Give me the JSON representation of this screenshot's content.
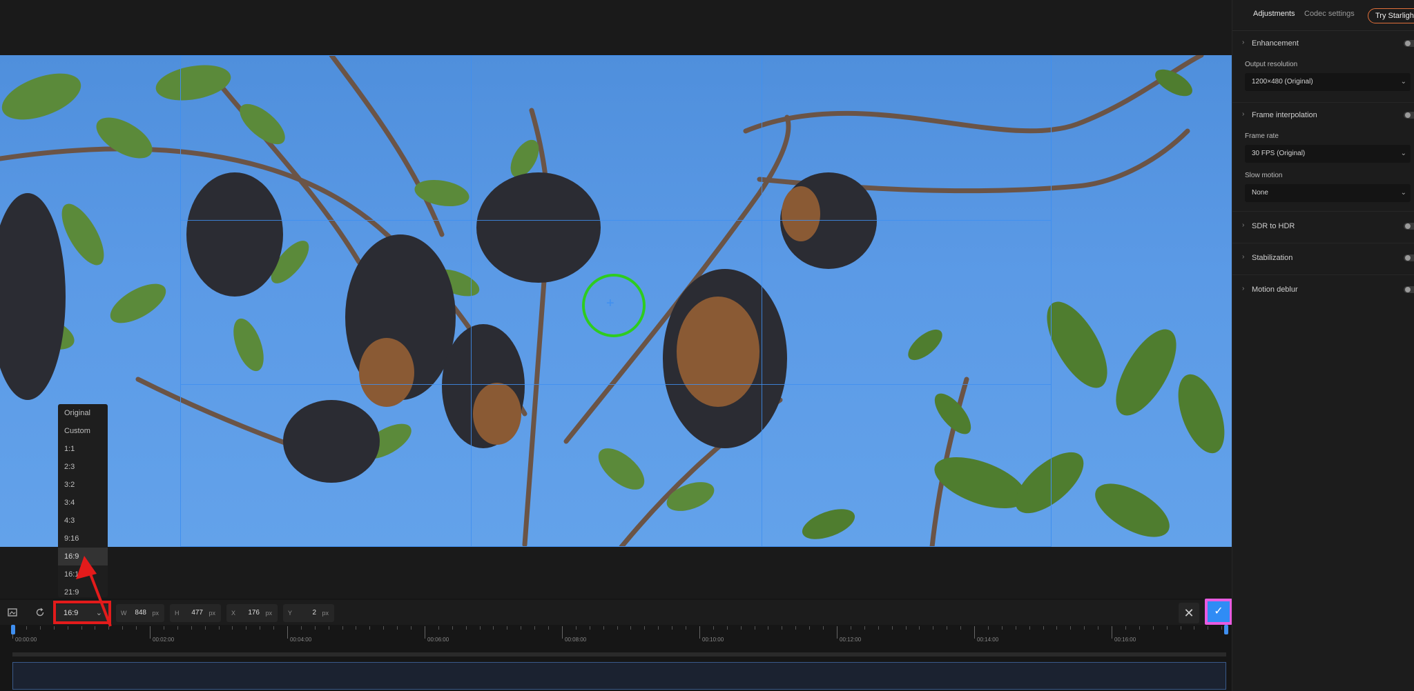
{
  "ratio_menu": {
    "options": [
      "Original",
      "Custom",
      "1:1",
      "2:3",
      "3:2",
      "3:4",
      "4:3",
      "9:16",
      "16:9",
      "16:10",
      "21:9"
    ],
    "selected": "16:9"
  },
  "toolbar": {
    "ratio_value": "16:9",
    "width": {
      "key": "W",
      "value": "848",
      "unit": "px"
    },
    "height": {
      "key": "H",
      "value": "477",
      "unit": "px"
    },
    "x": {
      "key": "X",
      "value": "176",
      "unit": "px"
    },
    "y": {
      "key": "Y",
      "value": "2",
      "unit": "px"
    },
    "close_symbol": "✕",
    "confirm_symbol": "✓"
  },
  "timeline": {
    "labels": [
      "00:00:00",
      "00:02:00",
      "00:04:00",
      "00:06:00",
      "00:08:00",
      "00:10:00",
      "00:12:00",
      "00:14:00",
      "00:16:00"
    ]
  },
  "panel": {
    "tabs": {
      "adjustments": "Adjustments",
      "codec": "Codec settings",
      "try": "Try Starlight"
    },
    "enhancement": {
      "title": "Enhancement",
      "output_resolution_label": "Output resolution",
      "output_resolution_value": "1200×480 (Original)"
    },
    "frame_interpolation": {
      "title": "Frame interpolation",
      "frame_rate_label": "Frame rate",
      "frame_rate_value": "30 FPS (Original)",
      "slow_motion_label": "Slow motion",
      "slow_motion_value": "None"
    },
    "sdr_to_hdr": {
      "title": "SDR to HDR"
    },
    "stabilization": {
      "title": "Stabilization"
    },
    "motion_deblur": {
      "title": "Motion deblur"
    }
  },
  "colors": {
    "crop_grid": "#3f8ff0",
    "focus_ring": "#2ecc1f",
    "highlight_red": "#e31b1b",
    "confirm_border": "#e85be0",
    "confirm_fill": "#2f8cf5",
    "try_border": "#e2703a"
  }
}
